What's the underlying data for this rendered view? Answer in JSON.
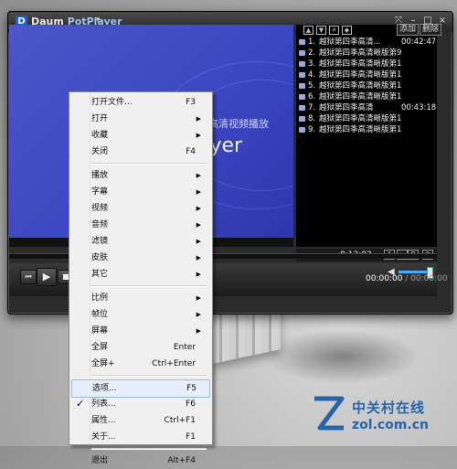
{
  "title": {
    "logo": "D",
    "brand": "Daum",
    "app": "PotPlayer",
    "dropdown_icon": "chevron-down-icon"
  },
  "window_buttons": [
    {
      "icon": "pin-icon",
      "glyph": "⤧"
    },
    {
      "icon": "minimize-icon",
      "glyph": "–"
    },
    {
      "icon": "maximize-icon",
      "glyph": "□"
    },
    {
      "icon": "close-icon",
      "glyph": "×"
    }
  ],
  "video": {
    "overlay_small": "高清视频播放",
    "overlay_text": "ayer"
  },
  "playlist": {
    "tool_glyphs": [
      "▲",
      "▼",
      "✕",
      "◆"
    ],
    "tabs": [
      "添加",
      "删除"
    ],
    "items": [
      {
        "num": "1.",
        "title": "越狱第四季高清...",
        "duration": "00:42:47"
      },
      {
        "num": "2.",
        "title": "越狱第四季高清晰版第9集...",
        "duration": ""
      },
      {
        "num": "3.",
        "title": "越狱第四季高清晰版第10...",
        "duration": ""
      },
      {
        "num": "4.",
        "title": "越狱第四季高清晰版第11...",
        "duration": ""
      },
      {
        "num": "5.",
        "title": "越狱第四季高清晰版第12...",
        "duration": ""
      },
      {
        "num": "6.",
        "title": "越狱第四季高清晰版第13...",
        "duration": ""
      },
      {
        "num": "7.",
        "title": "越狱第四季高清",
        "duration": "00:43:18"
      },
      {
        "num": "8.",
        "title": "越狱第四季高清晰版第15...",
        "duration": ""
      },
      {
        "num": "9.",
        "title": "越狱第四季高清晰版第16...",
        "duration": ""
      }
    ],
    "status_time": "8:13:03",
    "status_buttons": [
      "A",
      "▸",
      "B",
      "⟳"
    ]
  },
  "controls": {
    "prev": "⏮",
    "play": "▶",
    "stop": "■",
    "volume_icon": "◀",
    "volume_level": 0.85,
    "time_current": "00:00:00",
    "time_sep": " / ",
    "time_total": "00:00:00"
  },
  "context_menu": {
    "items": [
      {
        "label": "打开文件...",
        "shortcut": "F3"
      },
      {
        "label": "打开",
        "submenu": true
      },
      {
        "label": "收藏",
        "submenu": true
      },
      {
        "label": "关闭",
        "shortcut": "F4"
      },
      {
        "separator": true
      },
      {
        "label": "播放",
        "submenu": true
      },
      {
        "label": "字幕",
        "submenu": true
      },
      {
        "label": "视频",
        "submenu": true
      },
      {
        "label": "音频",
        "submenu": true
      },
      {
        "label": "滤镜",
        "submenu": true
      },
      {
        "label": "皮肤",
        "submenu": true
      },
      {
        "label": "其它",
        "submenu": true
      },
      {
        "separator": true
      },
      {
        "label": "比例",
        "submenu": true
      },
      {
        "label": "帧位",
        "submenu": true
      },
      {
        "label": "屏幕",
        "submenu": true
      },
      {
        "label": "全屏",
        "shortcut": "Enter"
      },
      {
        "label": "全屏+",
        "shortcut": "Ctrl+Enter"
      },
      {
        "separator": true
      },
      {
        "label": "选项...",
        "shortcut": "F5",
        "highlighted": true
      },
      {
        "label": "列表...",
        "shortcut": "F6",
        "checked": true
      },
      {
        "label": "属性...",
        "shortcut": "Ctrl+F1"
      },
      {
        "label": "关于...",
        "shortcut": "F1"
      },
      {
        "separator": true
      },
      {
        "label": "退出",
        "shortcut": "Alt+F4"
      }
    ]
  },
  "watermark": {
    "cn": "中关村在线",
    "en": "zol.com.cn"
  },
  "colors": {
    "video_bg": "#4350c6",
    "highlight": "#e6eefb",
    "watermark": "#2a64a8"
  }
}
